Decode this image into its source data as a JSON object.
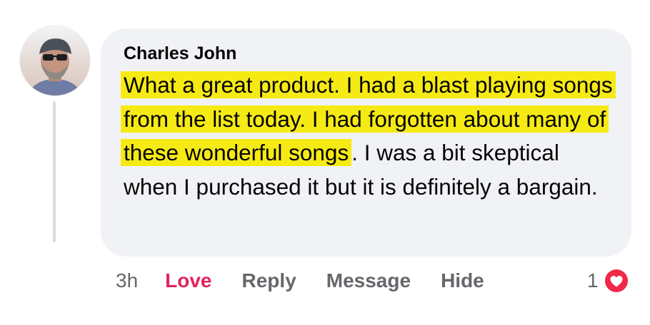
{
  "comment": {
    "author": "Charles John",
    "highlighted_text": "What a great product. I had a blast playing songs from the list today. I had forgotten about many of these wonderful songs",
    "plain_text": ". I was a bit skeptical when I purchased it but it is definitely a bargain.",
    "highlight_color": "#f6ea14",
    "bubble_color": "#f0f2f5"
  },
  "actions": {
    "timestamp": "3h",
    "love_label": "Love",
    "reply_label": "Reply",
    "message_label": "Message",
    "hide_label": "Hide",
    "love_color": "#e0245e"
  },
  "reactions": {
    "count": "1",
    "icon": "heart-icon",
    "icon_color": "#f02849"
  }
}
